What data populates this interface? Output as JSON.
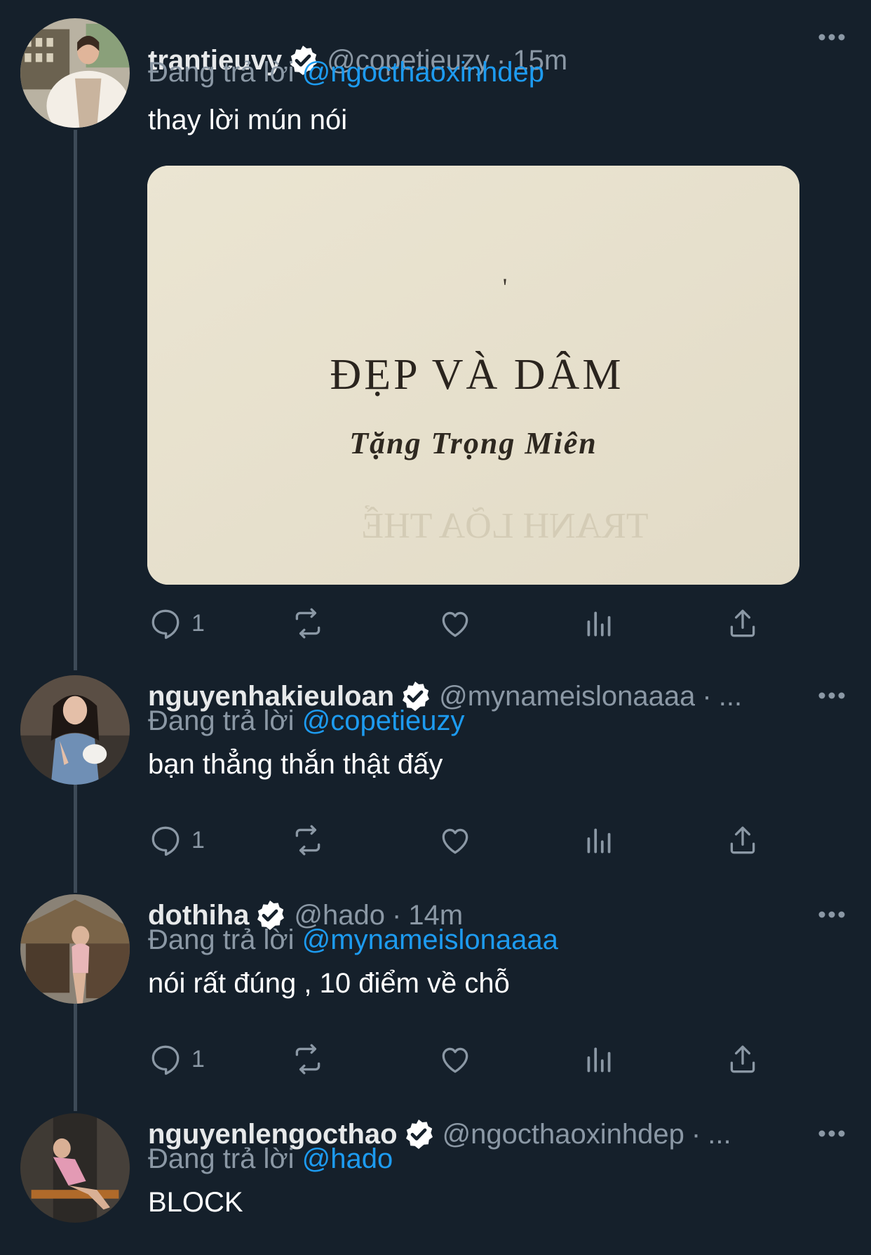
{
  "tweets": [
    {
      "name": "trantieuvy",
      "handle": "@copetieuzy",
      "separator": "·",
      "time": "15m",
      "reply_prefix": "Đang trả lời",
      "reply_to": "@ngocthaoxinhdep",
      "text": "thay lời mún nói",
      "media": {
        "title": "ĐẸP VÀ DÂM",
        "subtitle": "Tặng Trọng Miên",
        "mark": "'",
        "bleed_text": "TRANH LÕA THỂ"
      },
      "actions": {
        "reply_count": "1"
      }
    },
    {
      "name": "nguyenhakieuloan",
      "handle": "@mynameislonaaaa",
      "separator": "·",
      "time": "...",
      "reply_prefix": "Đang trả lời",
      "reply_to": "@copetieuzy",
      "text": "bạn thẳng thắn thật đấy",
      "actions": {
        "reply_count": "1"
      }
    },
    {
      "name": "dothiha",
      "handle": "@hado",
      "separator": "·",
      "time": "14m",
      "reply_prefix": "Đang trả lời",
      "reply_to": "@mynameislonaaaa",
      "text": "nói rất đúng , 10 điểm về chỗ",
      "actions": {
        "reply_count": "1"
      }
    },
    {
      "name": "nguyenlengocthao",
      "handle": "@ngocthaoxinhdep",
      "separator": "·",
      "time": "...",
      "reply_prefix": "Đang trả lời",
      "reply_to": "@hado",
      "text": "BLOCK"
    }
  ],
  "icons": {
    "verified": "verified-badge-icon",
    "more": "more-dots-icon",
    "reply": "reply-icon",
    "retweet": "retweet-icon",
    "like": "heart-icon",
    "views": "views-bar-chart-icon",
    "share": "share-icon"
  },
  "colors": {
    "background": "#15202b",
    "mention": "#1d9bf0",
    "secondary_text": "#8b98a5",
    "thread_line": "#3d4a57"
  }
}
